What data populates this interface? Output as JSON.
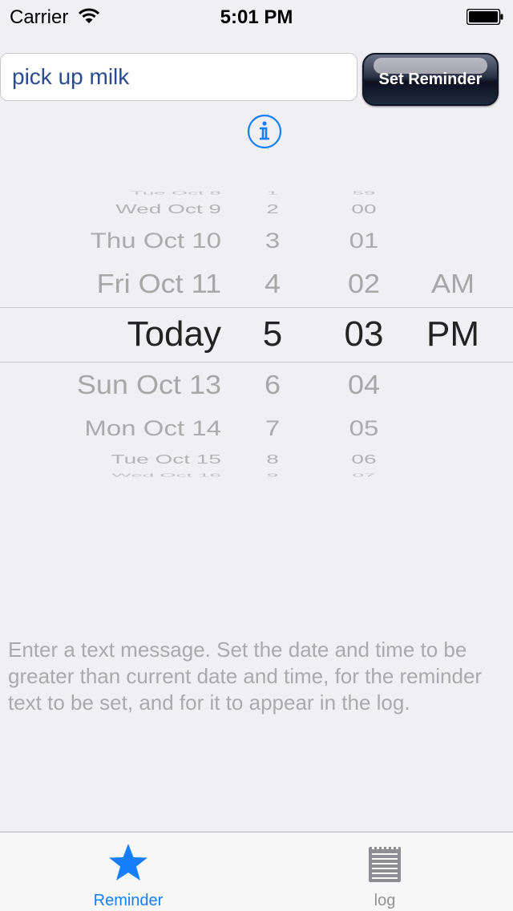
{
  "status_bar": {
    "carrier": "Carrier",
    "time": "5:01 PM"
  },
  "reminder_input": {
    "value": "pick up milk",
    "placeholder": ""
  },
  "set_reminder_button": {
    "label": "Set Reminder"
  },
  "info_icon": "info-icon",
  "picker": {
    "date": {
      "above": [
        "Tue Oct 8",
        "Wed Oct 9",
        "Thu Oct 10",
        "Fri Oct 11"
      ],
      "selected": "Today",
      "below": [
        "Sun Oct 13",
        "Mon Oct 14",
        "Tue Oct 15",
        "Wed Oct 16"
      ]
    },
    "hour": {
      "above": [
        "1",
        "2",
        "3",
        "4"
      ],
      "selected": "5",
      "below": [
        "6",
        "7",
        "8",
        "9"
      ]
    },
    "minute": {
      "above": [
        "59",
        "00",
        "01",
        "02"
      ],
      "selected": "03",
      "below": [
        "04",
        "05",
        "06",
        "07"
      ]
    },
    "ampm": {
      "above": [
        "",
        "",
        "",
        "AM"
      ],
      "selected": "PM",
      "below": [
        "",
        "",
        "",
        ""
      ]
    }
  },
  "help_text": "Enter a text message. Set the date and time to be greater than current date and time, for the reminder text to be set, and for it to appear in the log.",
  "tab_bar": {
    "tabs": [
      {
        "label": "Reminder",
        "icon": "star-icon",
        "selected": true
      },
      {
        "label": "log",
        "icon": "notepad-icon",
        "selected": false
      }
    ]
  },
  "colors": {
    "accent": "#157efb",
    "background": "#efeff4",
    "input_text": "#2a4b8d"
  }
}
